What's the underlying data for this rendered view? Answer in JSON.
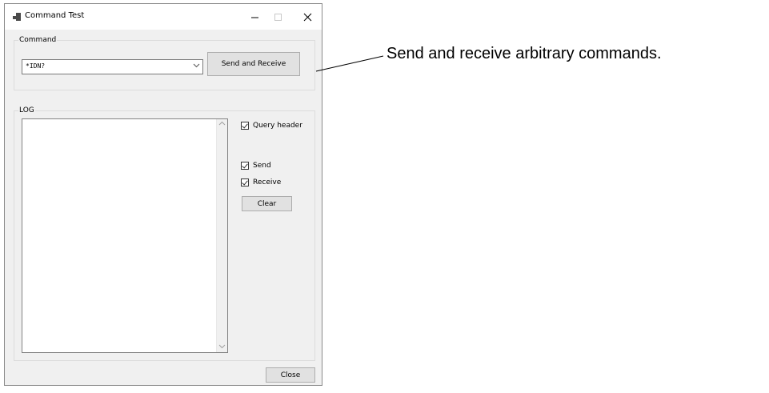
{
  "window": {
    "title": "Command Test",
    "controls": {
      "minimize": "–",
      "maximize": "□",
      "close": "✕"
    }
  },
  "command_group": {
    "legend": "Command",
    "combo_value": "*IDN?",
    "send_button": "Send and Receive"
  },
  "log_group": {
    "legend": "LOG",
    "log_text": "",
    "query_header_label": "Query header",
    "query_header_checked": true,
    "send_label": "Send",
    "send_checked": true,
    "receive_label": "Receive",
    "receive_checked": true,
    "clear_button": "Clear"
  },
  "close_button": "Close",
  "annotation": {
    "text": "Send and receive arbitrary commands."
  }
}
